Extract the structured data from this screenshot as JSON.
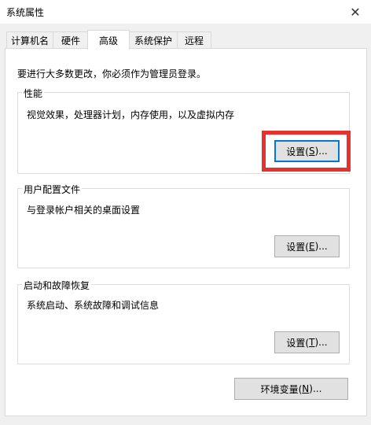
{
  "window": {
    "title": "系统属性"
  },
  "tabs": [
    {
      "label": "计算机名"
    },
    {
      "label": "硬件"
    },
    {
      "label": "高级"
    },
    {
      "label": "系统保护"
    },
    {
      "label": "远程"
    }
  ],
  "active_tab": "高级",
  "admin_note": "要进行大多数更改，你必须作为管理员登录。",
  "groups": {
    "performance": {
      "title": "性能",
      "description": "视觉效果，处理器计划，内存使用，以及虚拟内存",
      "button": {
        "pre": "设置(",
        "mnemonic": "S",
        "post": ")..."
      }
    },
    "profiles": {
      "title": "用户配置文件",
      "description": "与登录帐户相关的桌面设置",
      "button": {
        "pre": "设置(",
        "mnemonic": "E",
        "post": ")..."
      }
    },
    "startup": {
      "title": "启动和故障恢复",
      "description": "系统启动、系统故障和调试信息",
      "button": {
        "pre": "设置(",
        "mnemonic": "T",
        "post": ")..."
      }
    }
  },
  "env_button": {
    "pre": "环境变量(",
    "mnemonic": "N",
    "post": ")..."
  },
  "colors": {
    "highlight_box": "#e8302d",
    "focus_border": "#0078d7",
    "button_face": "#e1e1e1"
  }
}
